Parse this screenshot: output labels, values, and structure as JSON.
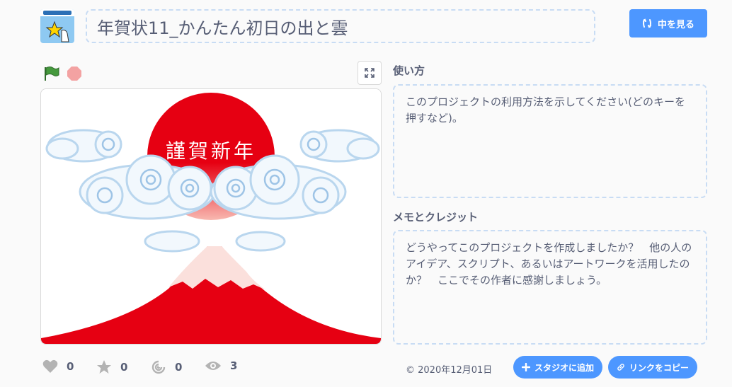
{
  "header": {
    "project_title": "年賀状11_かんたん初日の出と雲",
    "see_inside_label": "中を見る"
  },
  "stage": {
    "greeting_text": "謹賀新年"
  },
  "instructions": {
    "heading": "使い方",
    "placeholder": "このプロジェクトの利用方法を示してください(どのキーを押すなど)。"
  },
  "notes": {
    "heading": "メモとクレジット",
    "placeholder": "どうやってこのプロジェクトを作成しましたか？　他の人のアイデア、スクリプト、あるいはアートワークを活用したのか？　ここでその作者に感謝しましょう。"
  },
  "stats": {
    "loves": "0",
    "favorites": "0",
    "remixes": "0",
    "views": "3"
  },
  "footer": {
    "share_date": "© 2020年12月01日",
    "add_to_studio_label": "スタジオに追加",
    "copy_link_label": "リンクをコピー"
  },
  "colors": {
    "accent": "#4d97ff",
    "sun_red": "#e60012",
    "flag_green": "#45993d",
    "stop_red": "#ec5959"
  }
}
